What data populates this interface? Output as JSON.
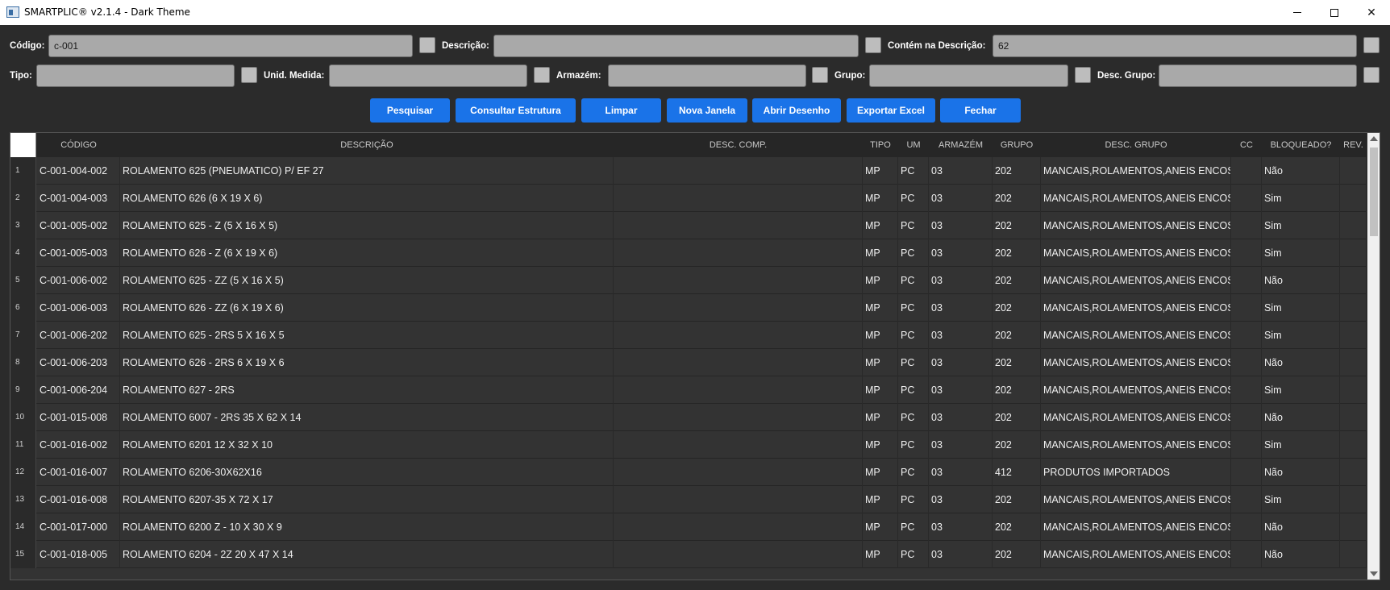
{
  "window": {
    "title": "SMARTPLIC® v2.1.4 - Dark Theme",
    "minimize_icon": "minimize-icon",
    "maximize_icon": "maximize-icon",
    "close_glyph": "✕"
  },
  "filters": {
    "codigo_label": "Código:",
    "codigo_value": "c-001",
    "descricao_label": "Descrição:",
    "descricao_value": "",
    "contem_label": "Contém na Descrição:",
    "contem_value": "62",
    "tipo_label": "Tipo:",
    "tipo_value": "",
    "unid_label": "Unid. Medida:",
    "unid_value": "",
    "armazem_label": "Armazém:",
    "armazem_value": "",
    "grupo_label": "Grupo:",
    "grupo_value": "",
    "descgrupo_label": "Desc. Grupo:",
    "descgrupo_value": ""
  },
  "buttons": {
    "pesquisar": "Pesquisar",
    "consultar": "Consultar Estrutura",
    "limpar": "Limpar",
    "nova_janela": "Nova Janela",
    "abrir_desenho": "Abrir Desenho",
    "exportar": "Exportar Excel",
    "fechar": "Fechar",
    "color": "#1a73e8"
  },
  "table": {
    "headers": [
      "CÓDIGO",
      "DESCRIÇÃO",
      "DESC. COMP.",
      "TIPO",
      "UM",
      "ARMAZÉM",
      "GRUPO",
      "DESC. GRUPO",
      "CC",
      "BLOQUEADO?",
      "REV."
    ],
    "rows": [
      {
        "n": "1",
        "codigo": "C-001-004-002",
        "descricao": "ROLAMENTO 625 (PNEUMATICO) P/ EF 27",
        "desc_comp": "",
        "tipo": "MP",
        "um": "PC",
        "armazem": "03",
        "grupo": "202",
        "desc_grupo": "MANCAIS,ROLAMENTOS,ANEIS ENCOS",
        "cc": "",
        "bloqueado": "Não",
        "rev": ""
      },
      {
        "n": "2",
        "codigo": "C-001-004-003",
        "descricao": "ROLAMENTO 626 (6 X 19 X 6)",
        "desc_comp": "",
        "tipo": "MP",
        "um": "PC",
        "armazem": "03",
        "grupo": "202",
        "desc_grupo": "MANCAIS,ROLAMENTOS,ANEIS ENCOS",
        "cc": "",
        "bloqueado": "Sim",
        "rev": ""
      },
      {
        "n": "3",
        "codigo": "C-001-005-002",
        "descricao": "ROLAMENTO 625 - Z (5 X 16 X 5)",
        "desc_comp": "",
        "tipo": "MP",
        "um": "PC",
        "armazem": "03",
        "grupo": "202",
        "desc_grupo": "MANCAIS,ROLAMENTOS,ANEIS ENCOS",
        "cc": "",
        "bloqueado": "Sim",
        "rev": ""
      },
      {
        "n": "4",
        "codigo": "C-001-005-003",
        "descricao": "ROLAMENTO 626 - Z (6 X 19 X 6)",
        "desc_comp": "",
        "tipo": "MP",
        "um": "PC",
        "armazem": "03",
        "grupo": "202",
        "desc_grupo": "MANCAIS,ROLAMENTOS,ANEIS ENCOS",
        "cc": "",
        "bloqueado": "Sim",
        "rev": ""
      },
      {
        "n": "5",
        "codigo": "C-001-006-002",
        "descricao": "ROLAMENTO 625 - ZZ (5 X 16 X 5)",
        "desc_comp": "",
        "tipo": "MP",
        "um": "PC",
        "armazem": "03",
        "grupo": "202",
        "desc_grupo": "MANCAIS,ROLAMENTOS,ANEIS ENCOS",
        "cc": "",
        "bloqueado": "Não",
        "rev": ""
      },
      {
        "n": "6",
        "codigo": "C-001-006-003",
        "descricao": "ROLAMENTO 626 - ZZ (6 X 19 X 6)",
        "desc_comp": "",
        "tipo": "MP",
        "um": "PC",
        "armazem": "03",
        "grupo": "202",
        "desc_grupo": "MANCAIS,ROLAMENTOS,ANEIS ENCOS",
        "cc": "",
        "bloqueado": "Sim",
        "rev": ""
      },
      {
        "n": "7",
        "codigo": "C-001-006-202",
        "descricao": "ROLAMENTO 625 - 2RS 5 X 16 X 5",
        "desc_comp": "",
        "tipo": "MP",
        "um": "PC",
        "armazem": "03",
        "grupo": "202",
        "desc_grupo": "MANCAIS,ROLAMENTOS,ANEIS ENCOS",
        "cc": "",
        "bloqueado": "Sim",
        "rev": ""
      },
      {
        "n": "8",
        "codigo": "C-001-006-203",
        "descricao": "ROLAMENTO 626 - 2RS 6 X 19 X 6",
        "desc_comp": "",
        "tipo": "MP",
        "um": "PC",
        "armazem": "03",
        "grupo": "202",
        "desc_grupo": "MANCAIS,ROLAMENTOS,ANEIS ENCOS",
        "cc": "",
        "bloqueado": "Não",
        "rev": ""
      },
      {
        "n": "9",
        "codigo": "C-001-006-204",
        "descricao": "ROLAMENTO 627 - 2RS",
        "desc_comp": "",
        "tipo": "MP",
        "um": "PC",
        "armazem": "03",
        "grupo": "202",
        "desc_grupo": "MANCAIS,ROLAMENTOS,ANEIS ENCOS",
        "cc": "",
        "bloqueado": "Sim",
        "rev": ""
      },
      {
        "n": "10",
        "codigo": "C-001-015-008",
        "descricao": "ROLAMENTO 6007 - 2RS 35 X 62 X 14",
        "desc_comp": "",
        "tipo": "MP",
        "um": "PC",
        "armazem": "03",
        "grupo": "202",
        "desc_grupo": "MANCAIS,ROLAMENTOS,ANEIS ENCOS",
        "cc": "",
        "bloqueado": "Não",
        "rev": ""
      },
      {
        "n": "11",
        "codigo": "C-001-016-002",
        "descricao": "ROLAMENTO 6201 12 X 32 X 10",
        "desc_comp": "",
        "tipo": "MP",
        "um": "PC",
        "armazem": "03",
        "grupo": "202",
        "desc_grupo": "MANCAIS,ROLAMENTOS,ANEIS ENCOS",
        "cc": "",
        "bloqueado": "Sim",
        "rev": ""
      },
      {
        "n": "12",
        "codigo": "C-001-016-007",
        "descricao": "ROLAMENTO 6206-30X62X16",
        "desc_comp": "",
        "tipo": "MP",
        "um": "PC",
        "armazem": "03",
        "grupo": "412",
        "desc_grupo": "PRODUTOS IMPORTADOS",
        "cc": "",
        "bloqueado": "Não",
        "rev": ""
      },
      {
        "n": "13",
        "codigo": "C-001-016-008",
        "descricao": "ROLAMENTO 6207-35 X 72 X 17",
        "desc_comp": "",
        "tipo": "MP",
        "um": "PC",
        "armazem": "03",
        "grupo": "202",
        "desc_grupo": "MANCAIS,ROLAMENTOS,ANEIS ENCOS",
        "cc": "",
        "bloqueado": "Sim",
        "rev": ""
      },
      {
        "n": "14",
        "codigo": "C-001-017-000",
        "descricao": "ROLAMENTO 6200 Z - 10 X 30 X 9",
        "desc_comp": "",
        "tipo": "MP",
        "um": "PC",
        "armazem": "03",
        "grupo": "202",
        "desc_grupo": "MANCAIS,ROLAMENTOS,ANEIS ENCOS",
        "cc": "",
        "bloqueado": "Não",
        "rev": ""
      },
      {
        "n": "15",
        "codigo": "C-001-018-005",
        "descricao": "ROLAMENTO 6204 - 2Z 20 X 47 X 14",
        "desc_comp": "",
        "tipo": "MP",
        "um": "PC",
        "armazem": "03",
        "grupo": "202",
        "desc_grupo": "MANCAIS,ROLAMENTOS,ANEIS ENCOS",
        "cc": "",
        "bloqueado": "Não",
        "rev": ""
      }
    ]
  }
}
